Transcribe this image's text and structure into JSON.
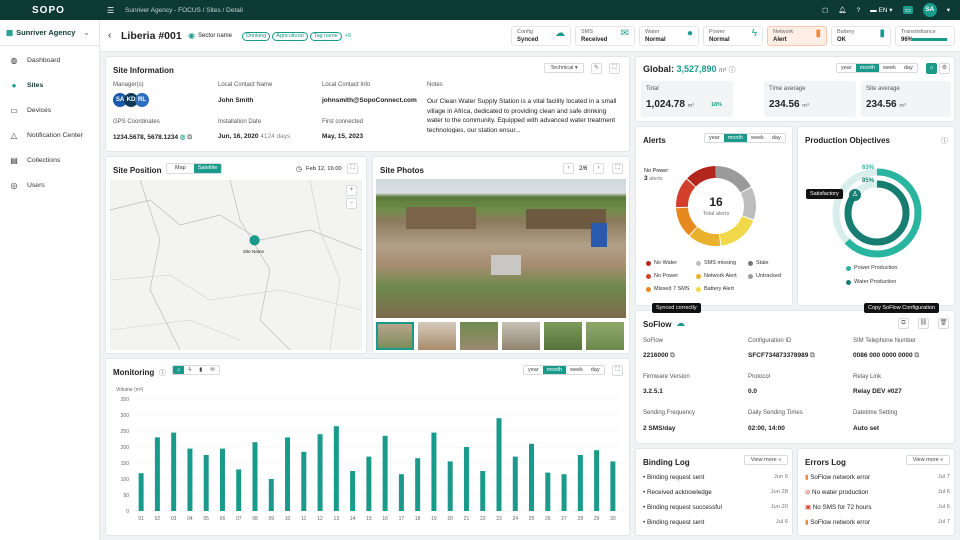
{
  "app": {
    "logo": "SOPO",
    "breadcrumb": "Sunriver Agency - FOCUS / Sites / Detail",
    "lang": "EN",
    "avatar": "SA"
  },
  "sidebar": {
    "org": "Sunriver Agency",
    "items": [
      {
        "label": "Dashboard",
        "icon": "grid-icon"
      },
      {
        "label": "Sites",
        "icon": "pin-icon"
      },
      {
        "label": "Devices",
        "icon": "device-icon"
      },
      {
        "label": "Notification Center",
        "icon": "warning-icon"
      },
      {
        "label": "Collections",
        "icon": "collection-icon"
      },
      {
        "label": "Users",
        "icon": "user-icon"
      }
    ]
  },
  "header": {
    "title": "Liberia #001",
    "sector": "Sector name",
    "tags": [
      "Drinking",
      "Agricultural",
      "Tag name"
    ],
    "more": "+5"
  },
  "status": [
    {
      "k": "Config",
      "v": "Synced"
    },
    {
      "k": "SMS",
      "v": "Received"
    },
    {
      "k": "Water",
      "v": "Normal"
    },
    {
      "k": "Power",
      "v": "Normal"
    },
    {
      "k": "Network",
      "v": "Alert"
    },
    {
      "k": "Battery",
      "v": "OK"
    },
    {
      "k": "Transmittance",
      "v": "96%"
    }
  ],
  "site_info": {
    "title": "Site Information",
    "mode": "Technical",
    "managers_label": "Manager(s)",
    "managers": [
      "SA",
      "KD",
      "RL"
    ],
    "contact_name_label": "Local Contact Name",
    "contact_name": "John Smith",
    "contact_info_label": "Local Contact Info",
    "contact_info": "johnsmith@SopoConnect.com",
    "notes_label": "Notes",
    "notes": "Our Clean Water Supply Station is a vital facility located in a small village in Africa, dedicated to providing clean and safe drinking water to the community. Equipped with advanced water treatment technologies, our station ensur...",
    "gps_label": "GPS Coordinates",
    "gps": "1234.5678, 5678.1234",
    "install_label": "Installation Date",
    "install": "Jun, 16, 2020",
    "install_days": "4124 days",
    "first_label": "First connected",
    "first": "May, 15, 2023"
  },
  "site_position": {
    "title": "Site Position",
    "tabs": [
      "Map",
      "Satellite"
    ],
    "date": "Feb 12, 16:00",
    "pin": "Site Name"
  },
  "photos": {
    "title": "Site Photos",
    "counter": "2/6"
  },
  "global": {
    "title": "Global:",
    "value": "3,527,890",
    "unit": "m³",
    "ranges": [
      "year",
      "month",
      "week",
      "day"
    ],
    "total_label": "Total",
    "total": "1,024.78",
    "total_unit": "m³",
    "total_pct": "18%",
    "time_avg_label": "Time average",
    "time_avg": "234.56",
    "site_avg_label": "Site average",
    "site_avg": "234.56"
  },
  "alerts": {
    "title": "Alerts",
    "ranges": [
      "year",
      "month",
      "week",
      "day"
    ],
    "total": "16",
    "total_label": "Total alerts",
    "tip": "No Power",
    "tip2": "3 alerts",
    "legend": [
      "No Water",
      "SMS missing",
      "Stale",
      "No Power",
      "Network Alert",
      "Untracked",
      "Missed 7 SMS",
      "Battery Alert"
    ]
  },
  "production": {
    "title": "Production Objectives",
    "p1": "63%",
    "p2": "85%",
    "tip": "Satisfactory",
    "legend": [
      "Power Production",
      "Water Production"
    ]
  },
  "soflow": {
    "title": "SoFlow",
    "tip": "Synced correctly",
    "copy_tip": "Copy SoFlow Configuration",
    "fields": [
      {
        "l": "SoFlow",
        "v": "2216000"
      },
      {
        "l": "Configuration ID",
        "v": "SFCF734873378989"
      },
      {
        "l": "SIM Telephone Number",
        "v": "0086 000 0000 0000"
      },
      {
        "l": "Firmware Version",
        "v": "3.2.5.1"
      },
      {
        "l": "Protocol",
        "v": "0.0"
      },
      {
        "l": "Relay Link",
        "v": "Relay DEV #027"
      },
      {
        "l": "Sending Frequency",
        "v": "2 SMS/day"
      },
      {
        "l": "Daily Sending Times",
        "v": "02:00, 14:00"
      },
      {
        "l": "Datetime Setting",
        "v": "Auto set"
      }
    ]
  },
  "monitoring": {
    "title": "Monitoring",
    "ranges": [
      "year",
      "month",
      "week",
      "day"
    ]
  },
  "chart_data": {
    "type": "bar",
    "ylabel": "Volume (m³)",
    "ylim": [
      0,
      350
    ],
    "yticks": [
      0,
      50,
      100,
      150,
      200,
      250,
      300,
      350
    ],
    "categories": [
      "01",
      "02",
      "03",
      "04",
      "05",
      "06",
      "07",
      "08",
      "09",
      "10",
      "11",
      "12",
      "13",
      "14",
      "15",
      "16",
      "17",
      "18",
      "19",
      "20",
      "21",
      "22",
      "23",
      "24",
      "25",
      "26",
      "27",
      "28",
      "29",
      "30"
    ],
    "values": [
      118,
      230,
      245,
      195,
      175,
      195,
      130,
      215,
      100,
      230,
      185,
      240,
      265,
      125,
      170,
      235,
      115,
      165,
      245,
      155,
      200,
      125,
      290,
      170,
      210,
      120,
      115,
      175,
      190,
      155
    ]
  },
  "binding_log": {
    "title": "Binding Log",
    "view": "View more",
    "items": [
      {
        "t": "Binding request sent",
        "d": "Jun 6"
      },
      {
        "t": "Received acknowledge",
        "d": "Jun 28"
      },
      {
        "t": "Binding request successful",
        "d": "Jun 20"
      },
      {
        "t": "Binding request sent",
        "d": "Jul 6"
      }
    ]
  },
  "errors_log": {
    "title": "Errors Log",
    "view": "View more",
    "items": [
      {
        "t": "SoFlow network error",
        "d": "Jul 7"
      },
      {
        "t": "No water production",
        "d": "Jul 6"
      },
      {
        "t": "No SMS for 72 hours",
        "d": "Jul 6"
      },
      {
        "t": "SoFlow network error",
        "d": "Jul 7"
      }
    ]
  },
  "colors": {
    "accent": "#1a9a8a",
    "dark": "#0e3a36"
  }
}
